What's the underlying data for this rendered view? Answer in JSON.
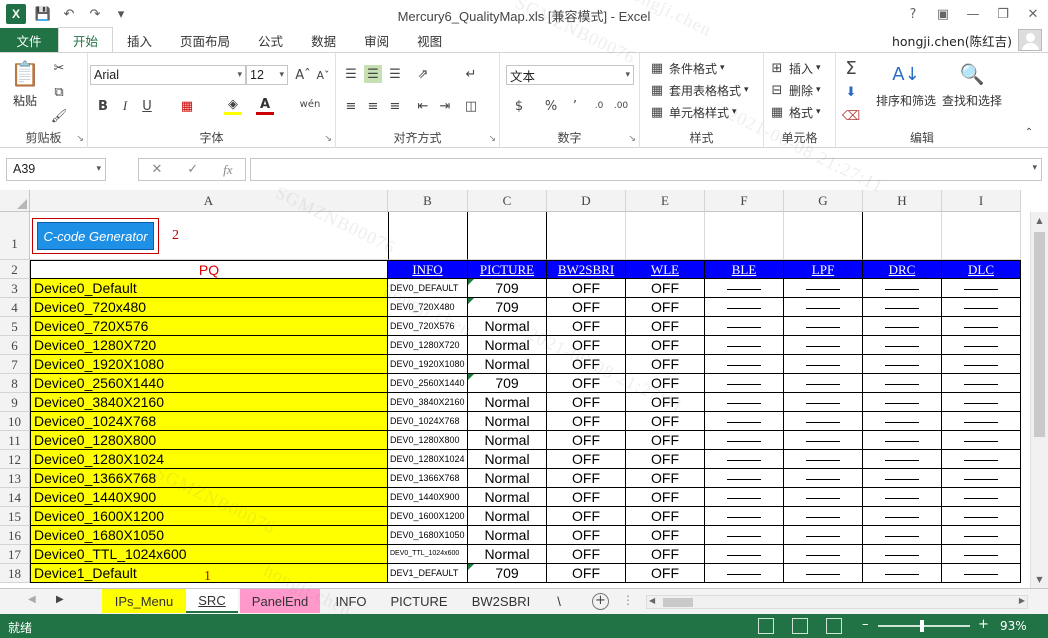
{
  "window": {
    "title": "Mercury6_QualityMap.xls  [兼容模式] - Excel",
    "help": "?",
    "ribbon_display": "☐"
  },
  "ribbon_tabs": [
    "文件",
    "开始",
    "插入",
    "页面布局",
    "公式",
    "数据",
    "审阅",
    "视图"
  ],
  "user": {
    "name": "hongji.chen(陈红吉)"
  },
  "ribbon": {
    "clipboard": {
      "label": "剪贴板",
      "paste": "粘贴"
    },
    "font": {
      "label": "字体",
      "name": "Arial",
      "size": "12",
      "phonetic": "wén"
    },
    "alignment": {
      "label": "对齐方式"
    },
    "number": {
      "label": "数字",
      "format": "文本"
    },
    "styles": {
      "label": "样式",
      "conditional": "条件格式",
      "table": "套用表格格式",
      "cell": "单元格样式"
    },
    "cells": {
      "label": "单元格",
      "insert": "插入",
      "delete": "删除",
      "format": "格式"
    },
    "editing": {
      "label": "编辑",
      "sort": "排序和筛选",
      "find": "查找和选择"
    }
  },
  "formula_bar": {
    "name_box": "A39",
    "fx": "fx",
    "value": ""
  },
  "columns": [
    "A",
    "B",
    "C",
    "D",
    "E",
    "F",
    "G",
    "H",
    "I"
  ],
  "sheet": {
    "button_label": "C-code Generator",
    "annotation_2": "2",
    "annotation_1": "1",
    "header_pq": "PQ",
    "headers": [
      "INFO",
      "PICTURE",
      "BW2SBRI",
      "WLE",
      "BLE",
      "LPF",
      "DRC",
      "DLC"
    ],
    "rows": [
      {
        "num": "1"
      },
      {
        "num": "2"
      },
      {
        "num": "3",
        "pq": "Device0_Default",
        "info": "DEV0_DEFAULT",
        "picture": "709",
        "bw2sbri": "OFF",
        "wle": "OFF"
      },
      {
        "num": "4",
        "pq": "Device0_720x480",
        "info": "DEV0_720X480",
        "picture": "709",
        "bw2sbri": "OFF",
        "wle": "OFF"
      },
      {
        "num": "5",
        "pq": "Device0_720X576",
        "info": "DEV0_720X576",
        "picture": "Normal",
        "bw2sbri": "OFF",
        "wle": "OFF"
      },
      {
        "num": "6",
        "pq": "Device0_1280X720",
        "info": "DEV0_1280X720",
        "picture": "Normal",
        "bw2sbri": "OFF",
        "wle": "OFF"
      },
      {
        "num": "7",
        "pq": "Device0_1920X1080",
        "info": "DEV0_1920X1080",
        "picture": "Normal",
        "bw2sbri": "OFF",
        "wle": "OFF"
      },
      {
        "num": "8",
        "pq": "Device0_2560X1440",
        "info": "DEV0_2560X1440",
        "picture": "709",
        "bw2sbri": "OFF",
        "wle": "OFF"
      },
      {
        "num": "9",
        "pq": "Device0_3840X2160",
        "info": "DEV0_3840X2160",
        "picture": "Normal",
        "bw2sbri": "OFF",
        "wle": "OFF"
      },
      {
        "num": "10",
        "pq": "Device0_1024X768",
        "info": "DEV0_1024X768",
        "picture": "Normal",
        "bw2sbri": "OFF",
        "wle": "OFF"
      },
      {
        "num": "11",
        "pq": "Device0_1280X800",
        "info": "DEV0_1280X800",
        "picture": "Normal",
        "bw2sbri": "OFF",
        "wle": "OFF"
      },
      {
        "num": "12",
        "pq": "Device0_1280X1024",
        "info": "DEV0_1280X1024",
        "picture": "Normal",
        "bw2sbri": "OFF",
        "wle": "OFF"
      },
      {
        "num": "13",
        "pq": "Device0_1366X768",
        "info": "DEV0_1366X768",
        "picture": "Normal",
        "bw2sbri": "OFF",
        "wle": "OFF"
      },
      {
        "num": "14",
        "pq": "Device0_1440X900",
        "info": "DEV0_1440X900",
        "picture": "Normal",
        "bw2sbri": "OFF",
        "wle": "OFF"
      },
      {
        "num": "15",
        "pq": "Device0_1600X1200",
        "info": "DEV0_1600X1200",
        "picture": "Normal",
        "bw2sbri": "OFF",
        "wle": "OFF"
      },
      {
        "num": "16",
        "pq": "Device0_1680X1050",
        "info": "DEV0_1680X1050",
        "picture": "Normal",
        "bw2sbri": "OFF",
        "wle": "OFF"
      },
      {
        "num": "17",
        "pq": "Device0_TTL_1024x600",
        "info": "DEV0_TTL_1024x600",
        "picture": "Normal",
        "bw2sbri": "OFF",
        "wle": "OFF"
      },
      {
        "num": "18",
        "pq": "Device1_Default",
        "info": "DEV1_DEFAULT",
        "picture": "709",
        "bw2sbri": "OFF",
        "wle": "OFF"
      }
    ]
  },
  "sheet_tabs": [
    "IPs_Menu",
    "SRC",
    "PanelEnd",
    "INFO",
    "PICTURE",
    "BW2SBRI",
    "\\"
  ],
  "status": {
    "text": "就绪",
    "zoom": "93%"
  },
  "watermarks": [
    "SGMZNB00076",
    "hongji.chen",
    "2021-06-08  21:27:11"
  ],
  "colors": {
    "accent": "#217346",
    "pq_fill": "#ffff00",
    "header_fill": "#0000ff",
    "button_fill": "#1e90e6",
    "annotation": "#c00000",
    "pink_tab": "#ff99cc"
  }
}
